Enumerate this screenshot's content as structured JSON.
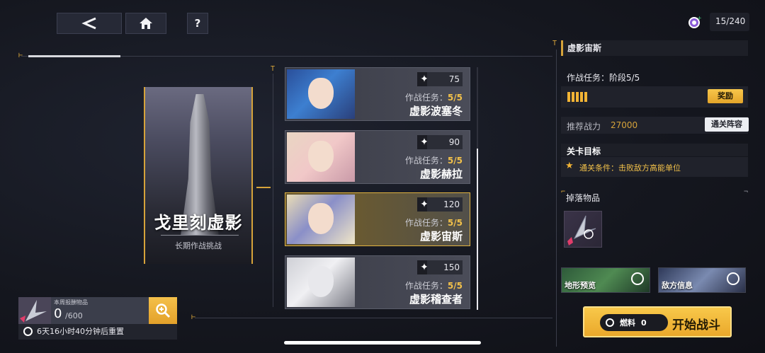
{
  "topbar": {
    "back_icon": "chevron-left-icon",
    "home_icon": "home-icon",
    "help_label": "?",
    "stamina": "15/240"
  },
  "main_card": {
    "title": "戈里刻虚影",
    "subtitle": "长期作战挑战"
  },
  "stages": [
    {
      "number": "75",
      "task_label": "作战任务：",
      "task_value": "5/5",
      "name": "虚影波塞冬",
      "active": false
    },
    {
      "number": "90",
      "task_label": "作战任务：",
      "task_value": "5/5",
      "name": "虚影赫拉",
      "active": false
    },
    {
      "number": "120",
      "task_label": "作战任务：",
      "task_value": "5/5",
      "name": "虚影宙斯",
      "active": true
    },
    {
      "number": "150",
      "task_label": "作战任务：",
      "task_value": "5/5",
      "name": "虚影稽查者",
      "active": false
    }
  ],
  "right_panel": {
    "title": "虚影宙斯",
    "task_progress": "作战任务：阶段5/5",
    "reward_label": "奖励",
    "power_label": "推荐战力",
    "power_value": "27000",
    "team_button": "通关阵容",
    "goal_header": "关卡目标",
    "goal_text": "通关条件：击败敌方高能单位",
    "drops_header": "掉落物品",
    "terrain_label": "地形预览",
    "enemy_label": "敌方信息",
    "fuel_label": "燃料",
    "fuel_value": "0",
    "start_label": "开始战斗"
  },
  "weekly": {
    "label": "本周报酬物品",
    "current": "0",
    "max": "/600",
    "reset_text": "6天16小时40分钟后重置"
  },
  "colors": {
    "accent": "#f2b435",
    "background": "#15171f"
  }
}
